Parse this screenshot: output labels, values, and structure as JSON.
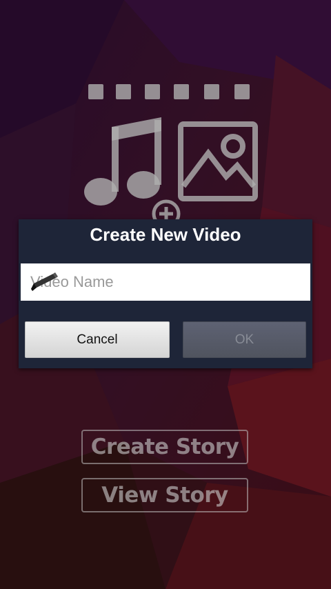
{
  "dialog": {
    "title": "Create New Video",
    "input_placeholder": "Video Name",
    "cancel_label": "Cancel",
    "ok_label": "OK"
  },
  "menu": {
    "create_story_label": "Create Story",
    "view_story_label": "View Story"
  },
  "icons": {
    "app_logo": "film-music-image-icon",
    "input": "pencil-icon"
  },
  "colors": {
    "dialog_bg": "#1e2538",
    "background_purple": "#4a1a4a",
    "background_red": "#7a1c2a"
  }
}
